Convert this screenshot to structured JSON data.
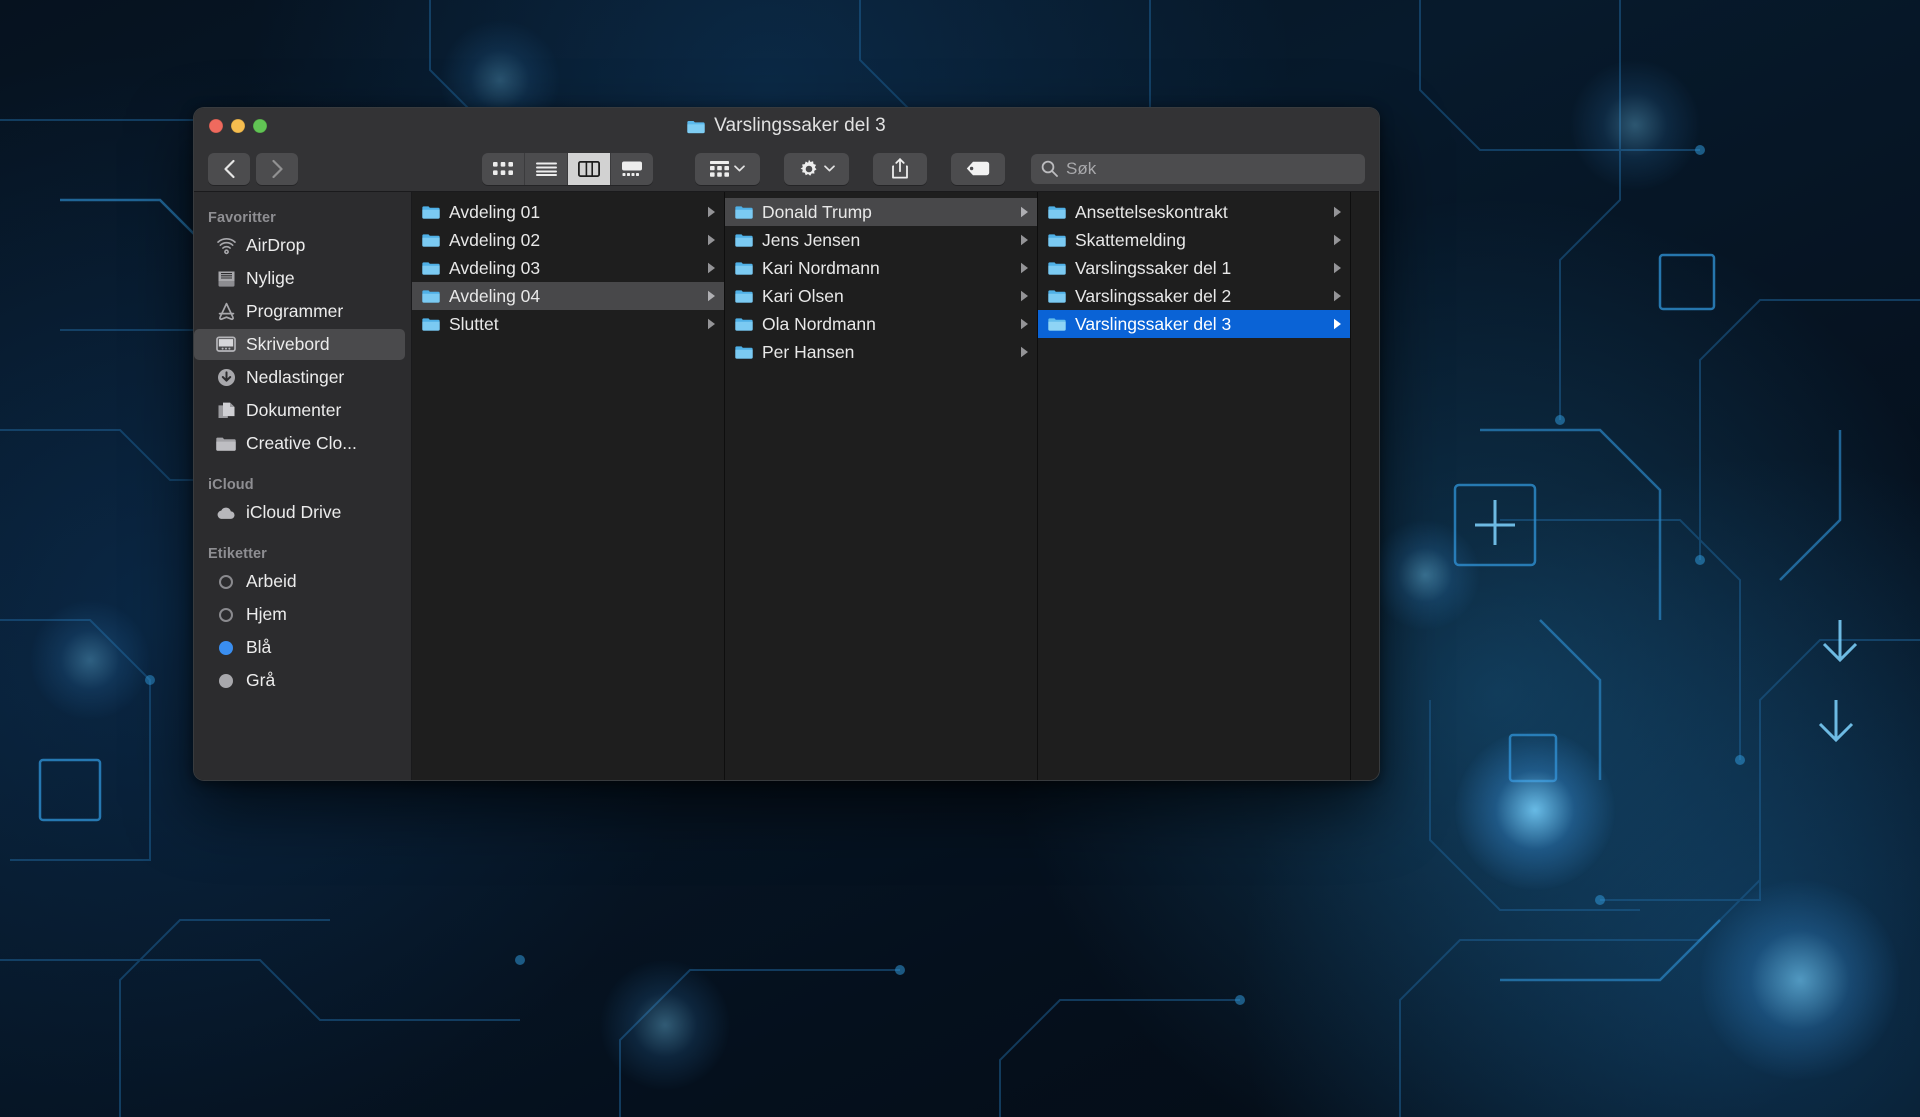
{
  "window": {
    "title": "Varslingssaker del 3",
    "title_icon": "folder-icon",
    "traffic_lights": [
      {
        "name": "close",
        "color": "#ef6a5e"
      },
      {
        "name": "minimize",
        "color": "#f5bd4f"
      },
      {
        "name": "zoom",
        "color": "#61c454"
      }
    ]
  },
  "toolbar": {
    "back_icon": "chevron-left-icon",
    "forward_icon": "chevron-right-icon",
    "view_modes": [
      {
        "icon": "icon-view-icon",
        "label": "Symboler",
        "active": false
      },
      {
        "icon": "list-view-icon",
        "label": "Liste",
        "active": false
      },
      {
        "icon": "column-view-icon",
        "label": "Kolonner",
        "active": true
      },
      {
        "icon": "gallery-view-icon",
        "label": "Galleri",
        "active": false
      }
    ],
    "group_button": {
      "icon": "group-by-icon",
      "chevron": "chevron-down-icon"
    },
    "action_button": {
      "icon": "gear-icon",
      "chevron": "chevron-down-icon"
    },
    "share_button": {
      "icon": "share-icon"
    },
    "tag_button": {
      "icon": "tag-icon"
    },
    "search": {
      "icon": "search-icon",
      "placeholder": "Søk",
      "value": ""
    }
  },
  "sidebar": {
    "sections": [
      {
        "header": "Favoritter",
        "items": [
          {
            "label": "AirDrop",
            "icon": "airdrop-icon",
            "selected": false
          },
          {
            "label": "Nylige",
            "icon": "recents-icon",
            "selected": false
          },
          {
            "label": "Programmer",
            "icon": "applications-icon",
            "selected": false
          },
          {
            "label": "Skrivebord",
            "icon": "desktop-icon",
            "selected": true
          },
          {
            "label": "Nedlastinger",
            "icon": "downloads-icon",
            "selected": false
          },
          {
            "label": "Dokumenter",
            "icon": "documents-icon",
            "selected": false
          },
          {
            "label": "Creative Clo...",
            "icon": "folder-icon",
            "selected": false
          }
        ]
      },
      {
        "header": "iCloud",
        "items": [
          {
            "label": "iCloud Drive",
            "icon": "icloud-icon",
            "selected": false
          }
        ]
      },
      {
        "header": "Etiketter",
        "items": [
          {
            "label": "Arbeid",
            "icon": "tag-dot-icon",
            "color": "none",
            "selected": false
          },
          {
            "label": "Hjem",
            "icon": "tag-dot-icon",
            "color": "none",
            "selected": false
          },
          {
            "label": "Blå",
            "icon": "tag-dot-icon",
            "color": "#3a8ef0",
            "selected": false
          },
          {
            "label": "Grå",
            "icon": "tag-dot-icon",
            "color": "#a8a8ac",
            "selected": false
          }
        ]
      }
    ]
  },
  "columns": [
    {
      "name": "column-1",
      "rows": [
        {
          "label": "Avdeling 01",
          "icon": "folder-icon",
          "has_chevron": true,
          "state": "none"
        },
        {
          "label": "Avdeling 02",
          "icon": "folder-icon",
          "has_chevron": true,
          "state": "none"
        },
        {
          "label": "Avdeling 03",
          "icon": "folder-icon",
          "has_chevron": true,
          "state": "none"
        },
        {
          "label": "Avdeling 04",
          "icon": "folder-icon",
          "has_chevron": true,
          "state": "selected-inactive"
        },
        {
          "label": "Sluttet",
          "icon": "folder-icon",
          "has_chevron": true,
          "state": "none"
        }
      ]
    },
    {
      "name": "column-2",
      "rows": [
        {
          "label": "Donald Trump",
          "icon": "folder-icon",
          "has_chevron": true,
          "state": "selected-inactive"
        },
        {
          "label": "Jens Jensen",
          "icon": "folder-icon",
          "has_chevron": true,
          "state": "none"
        },
        {
          "label": "Kari Nordmann",
          "icon": "folder-icon",
          "has_chevron": true,
          "state": "none"
        },
        {
          "label": "Kari Olsen",
          "icon": "folder-icon",
          "has_chevron": true,
          "state": "none"
        },
        {
          "label": "Ola Nordmann",
          "icon": "folder-icon",
          "has_chevron": true,
          "state": "none"
        },
        {
          "label": "Per Hansen",
          "icon": "folder-icon",
          "has_chevron": true,
          "state": "none"
        }
      ]
    },
    {
      "name": "column-3",
      "rows": [
        {
          "label": "Ansettelseskontrakt",
          "icon": "folder-icon",
          "has_chevron": true,
          "state": "none"
        },
        {
          "label": "Skattemelding",
          "icon": "folder-icon",
          "has_chevron": true,
          "state": "none"
        },
        {
          "label": "Varslingssaker del 1",
          "icon": "folder-icon",
          "has_chevron": true,
          "state": "none"
        },
        {
          "label": "Varslingssaker del 2",
          "icon": "folder-icon",
          "has_chevron": true,
          "state": "none"
        },
        {
          "label": "Varslingssaker del 3",
          "icon": "folder-icon",
          "has_chevron": true,
          "state": "selected-active"
        }
      ]
    }
  ],
  "colors": {
    "selection_active": "#0a63d6",
    "selection_inactive": "#48484a",
    "folder_blue": "#61b9ec",
    "window_chrome": "#333335",
    "sidebar_bg": "#2c2c2e",
    "column_bg": "#1e1e1e"
  }
}
